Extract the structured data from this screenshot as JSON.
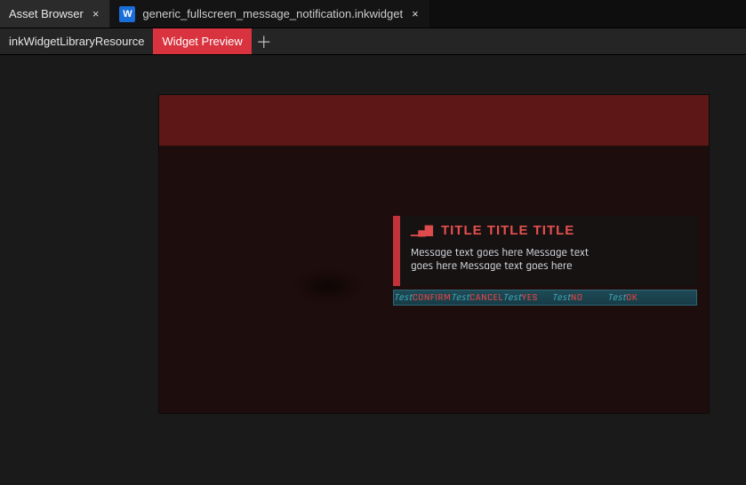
{
  "top_tabs": {
    "t0": {
      "label": "Asset Browser"
    },
    "t1": {
      "label": "generic_fullscreen_message_notification.inkwidget",
      "icon_letter": "W"
    }
  },
  "sub_tabs": {
    "res": "inkWidgetLibraryResource",
    "preview": "Widget Preview"
  },
  "notification": {
    "title": "TITLE TITLE TITLE",
    "message": "Message text goes here Message text goes here Message text goes here",
    "hints": {
      "p0": "Test",
      "l0": "CONFIRM",
      "p1": "Test",
      "l1": "CANCEL",
      "p2": "Test",
      "l2": "YES",
      "p3": "Test",
      "l3": "NO",
      "p4": "Test",
      "l4": "OK"
    }
  }
}
